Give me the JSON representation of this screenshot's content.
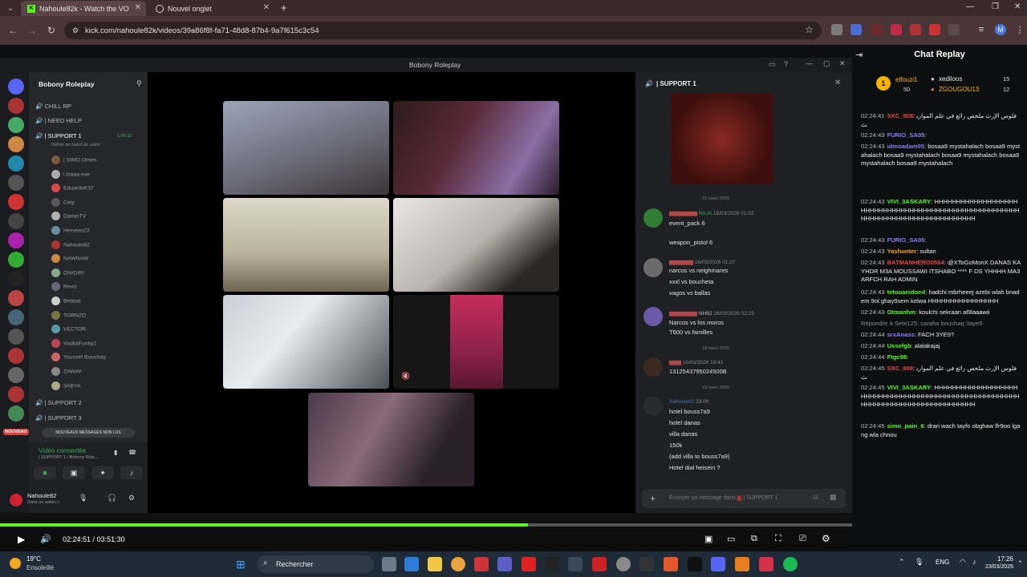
{
  "browser": {
    "tab1_title": "Nahoule82k - Watch the VO",
    "tab2_title": "Nouvel onglet",
    "url": "kick.com/nahoule82k/videos/39a86f8f-fa71-48d8-87b4-9a7f615c3c54"
  },
  "discord": {
    "window_title": "Bobony Roleplay",
    "server_name": "Bobony Roleplay",
    "channels": {
      "chill": "CHILL RP",
      "need_help": "| NEED HELP",
      "support1": "| SUPPORT 1",
      "status_hint": "Définir un statut de salon",
      "support1_time": "1:56:32",
      "support2": "| SUPPORT 2",
      "support3": "| SUPPORT 3"
    },
    "members": [
      "| SIMO Ornes",
      "l.Izaaa.exe",
      "EduardoK37",
      "Cety",
      "DanasTV",
      "Heiseen23",
      "Nahoule82",
      "NAWNAW",
      "ONIGIRI",
      "Reviz",
      "Bebbat",
      "TORNZO",
      "VECTOR",
      "VodkaFunky1",
      "Youssef Boushaq",
      "ZAWAF",
      "3ABYA"
    ],
    "new_messages": "NOUVEAUX MESSAGES NON LUS",
    "nouveau_badge": "NOUVEAU",
    "voice_connected": "Vidéo connectée",
    "voice_channel": "| SUPPORT 1 / Bobony Role...",
    "user_name": "Nahoule82",
    "user_status": "Dans un salon v",
    "chat_title": "| SUPPORT 1",
    "dates": [
      "16 mars 2026",
      "18 mars 2026",
      "23 mars 2026"
    ],
    "msg1": [
      "event_pack 6",
      "weapon_pistol 6"
    ],
    "msg2": [
      "narcos vs neighmares",
      "xxxl vs boucheta",
      "vagos vs ballas"
    ],
    "msg3": [
      "Narcos vs los moros",
      "T600 vs familles"
    ],
    "msg4": [
      "1312543795024500B"
    ],
    "msg5": [
      "hotel bouss7a9",
      "hotel danas",
      "villa danas",
      "150k",
      "(add villa to bouss7a9)",
      "Hotel dial heisein ?"
    ],
    "msg1_time": "16/03/2026 01:02",
    "msg2_time": "16/03/2026 01:37",
    "msg3_time": "16/03/2026 02:23",
    "msg4_time": "16/03/2026 19:41",
    "msg5_author": "Nahoule82",
    "msg5_time": "23:00",
    "input_placeholder": "Envoyer un message dans",
    "input_channel": "| SUPPORT 1"
  },
  "player": {
    "time_current": "02:24:51",
    "time_total": "03:51:30",
    "progress_fraction": 0.62
  },
  "kick_chat": {
    "title": "Chat Replay",
    "leaders": [
      {
        "name": "elfouzi1",
        "value": "50"
      },
      {
        "name": "xediloos",
        "value": "15"
      },
      {
        "name": "ZGOUGOU13",
        "value": "12"
      }
    ],
    "messages": [
      {
        "time": "02:24:41",
        "user": "SXC_808",
        "color": "#e5484d",
        "text": "فلوس الإرث ملخص رائع في علم المواريث"
      },
      {
        "time": "02:24:43",
        "user": "FURIO_SA05",
        "color": "#8e7cf0",
        "text": ""
      },
      {
        "time": "02:24:43",
        "user": "idmoadam05",
        "color": "#8e7cf0",
        "text": "bosaa9 mystahalach bosaa9 mystahalach bosaa9 mystahalach bosaa9 mystahalach bosaa9 mystahalach bosaa9 mystahalach"
      },
      {
        "time": "02:24:43",
        "user": "VIVI_3ASKARY",
        "color": "#53fc18",
        "text": "HHHHHHHHHHHHHHHHHHHHHHHHHHHHHHHHHHHHHHHHHHHHHHHHHHHHHHHHHHHHHHHHHHHHHHHHHHHHHHHHH"
      },
      {
        "time": "02:24:43",
        "user": "FURIO_SA05",
        "color": "#8e7cf0",
        "text": ""
      },
      {
        "time": "02:24:43",
        "user": "Yashunter",
        "color": "#f5a623",
        "text": "sultan"
      },
      {
        "time": "02:24:43",
        "user": "BATMANHERO0564",
        "color": "#e5484d",
        "text": "@XToGoMoriX DANAS KAYHDR M3A MOUSSAWI ITSHABO **** F DS YHHHH MA3ARFCH RAH ADMIN"
      },
      {
        "time": "02:24:43",
        "user": "tetouanidon4",
        "color": "#53fc18",
        "text": "hadchi mbrheeej azebi wlah bnadem 9ol ghay9sem kelwa HHHHHHHHHHHHHHHH"
      },
      {
        "time": "02:24:43",
        "user": "Otmanhm",
        "color": "#53fc18",
        "text": "koulchi sekraan al9laaawii"
      },
      {
        "time": "",
        "user": "",
        "color": "#888",
        "text": "Répondre à Sete125: saraha boushaq 3aye9"
      },
      {
        "time": "02:24:44",
        "user": "srxAnass",
        "color": "#8e7cf0",
        "text": "FACH 3YE9?"
      },
      {
        "time": "02:24:44",
        "user": "Ussefgb",
        "color": "#53fc18",
        "text": "alalakajaj"
      },
      {
        "time": "02:24:44",
        "user": "Ftgc98",
        "color": "#53fc18",
        "text": ""
      },
      {
        "time": "02:24:45",
        "user": "SXC_808",
        "color": "#e5484d",
        "text": "فلوس الإرث ملخص رائع في علم المواريث"
      },
      {
        "time": "02:24:45",
        "user": "VIVI_3ASKARY",
        "color": "#53fc18",
        "text": "HHHHHHHHHHHHHHHHHHHHHHHHHHHHHHHHHHHHHHHHHHHHHHHHHHHHHHHHHHHHHHHHHHHHHHHHHHHHHHHHH"
      },
      {
        "time": "02:24:45",
        "user": "simo_pain_6",
        "color": "#53fc18",
        "text": "drari wach tayfo obghaw lfr9oo lgang wla chnou"
      }
    ]
  },
  "taskbar": {
    "weather_temp": "19°C",
    "weather_desc": "Ensoleillé",
    "search_label": "Rechercher",
    "lang": "ENG",
    "time": "17:26",
    "date": "23/03/2026"
  },
  "colors": {
    "kick_green": "#53fc18",
    "discord_bg": "#26272b"
  }
}
